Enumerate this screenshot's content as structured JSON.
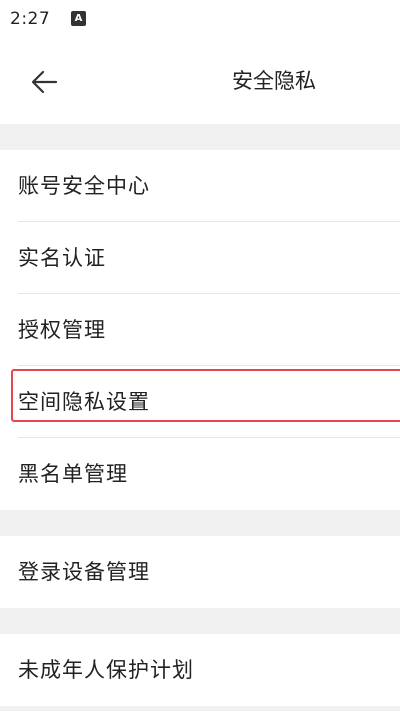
{
  "status_bar": {
    "time": "2:27",
    "notification_badge": "A"
  },
  "header": {
    "back_icon": "arrow-left-icon",
    "title": "安全隐私"
  },
  "groups": [
    {
      "items": [
        {
          "label": "账号安全中心"
        },
        {
          "label": "实名认证"
        },
        {
          "label": "授权管理"
        },
        {
          "label": "空间隐私设置",
          "highlighted": true
        },
        {
          "label": "黑名单管理"
        }
      ]
    },
    {
      "items": [
        {
          "label": "登录设备管理"
        }
      ]
    },
    {
      "items": [
        {
          "label": "未成年人保护计划"
        }
      ]
    }
  ],
  "colors": {
    "background": "#ffffff",
    "section_gap": "#f0f0f0",
    "divider": "#e6e6e6",
    "highlight_border": "#e5474f",
    "text": "#222222"
  }
}
